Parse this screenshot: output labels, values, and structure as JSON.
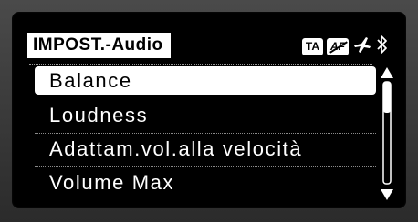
{
  "header": {
    "title": "IMPOST.-Audio",
    "badges": {
      "ta": "TA",
      "af": "AF"
    },
    "icons": [
      "plane-icon",
      "bluetooth-icon"
    ]
  },
  "menu": {
    "items": [
      {
        "label": "Balance",
        "selected": true
      },
      {
        "label": "Loudness",
        "selected": false
      },
      {
        "label": "Adattam.vol.alla velocità",
        "selected": false
      },
      {
        "label": "Volume Max",
        "selected": false
      }
    ]
  },
  "colors": {
    "background": "#000000",
    "foreground": "#ffffff",
    "bezel": "#3a3a3a"
  }
}
